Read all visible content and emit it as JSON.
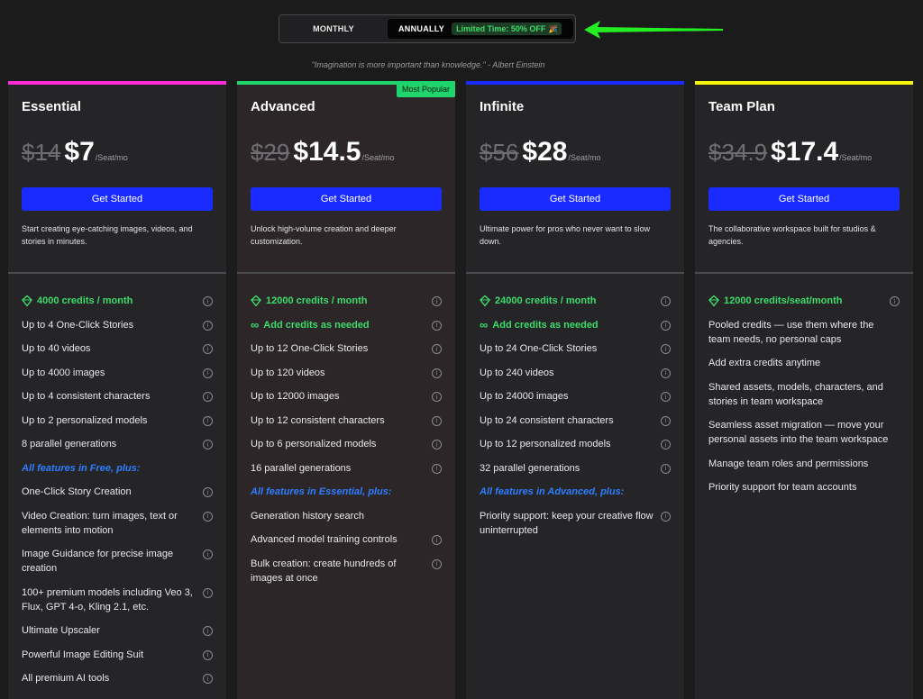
{
  "toggle": {
    "monthly_label": "MONTHLY",
    "annual_label": "ANNUALLY",
    "promo_label": "Limited Time: 50% OFF",
    "promo_icon": "🎉",
    "selected": "annually"
  },
  "quote": "\"Imagination is more important than knowledge.\" - Albert Einstein",
  "colors": {
    "essential_bar": "#ff2bd6",
    "advanced_bar": "#1ed46b",
    "infinite_bar": "#1a2bff",
    "team_bar": "#f4f40c",
    "button": "#1a2bff",
    "credits_green": "#3ddc6a",
    "section_blue": "#2f7dff"
  },
  "plans": [
    {
      "name": "Essential",
      "old_price": "$14",
      "price": "$7",
      "unit": "/Seat/mo",
      "button": "Get Started",
      "description": "Start creating eye-catching images, videos, and stories in minutes.",
      "credits": "4000 credits / month",
      "features": [
        "Up to 4 One-Click Stories",
        "Up to 40 videos",
        "Up to 4000 images",
        "Up to 4 consistent characters",
        "Up to 2 personalized models",
        "8 parallel generations"
      ],
      "section": "All features in Free, plus:",
      "extras": [
        "One-Click Story Creation",
        "Video Creation: turn images, text or elements into motion",
        "Image Guidance for precise image creation",
        "100+ premium models including Veo 3, Flux, GPT 4-o, Kling 2.1, etc.",
        "Ultimate Upscaler",
        "Powerful Image Editing Suit",
        "All premium AI tools"
      ]
    },
    {
      "name": "Advanced",
      "badge": "Most Popular",
      "old_price": "$29",
      "price": "$14.5",
      "unit": "/Seat/mo",
      "button": "Get Started",
      "description": "Unlock high-volume creation and deeper customization.",
      "credits": "12000 credits / month",
      "add_credits": "Add credits as needed",
      "features": [
        "Up to 12 One-Click Stories",
        "Up to 120 videos",
        "Up to 12000 images",
        "Up to 12 consistent characters",
        "Up to 6 personalized models",
        "16 parallel generations"
      ],
      "section": "All features in Essential, plus:",
      "extras": [
        "Generation history search",
        "Advanced model training controls",
        "Bulk creation: create hundreds of images at once"
      ]
    },
    {
      "name": "Infinite",
      "old_price": "$56",
      "price": "$28",
      "unit": "/Seat/mo",
      "button": "Get Started",
      "description": "Ultimate power for pros who never want to slow down.",
      "credits": "24000 credits / month",
      "add_credits": "Add credits as needed",
      "features": [
        "Up to 24 One-Click Stories",
        "Up to 240 videos",
        "Up to 24000 images",
        "Up to 24 consistent characters",
        "Up to 12 personalized models",
        "32 parallel generations"
      ],
      "section": "All features in Advanced, plus:",
      "extras": [
        "Priority support: keep your creative flow uninterrupted"
      ]
    },
    {
      "name": "Team Plan",
      "old_price": "$34.9",
      "price": "$17.4",
      "unit": "/Seat/mo",
      "button": "Get Started",
      "description": "The collaborative workspace built for studios & agencies.",
      "credits": "12000 credits/seat/month",
      "team_features": [
        "Pooled credits — use them where the team needs, no personal caps",
        "Add extra credits anytime",
        "Shared assets, models, characters, and stories in team workspace",
        "Seamless asset migration — move your personal assets into the team workspace",
        "Manage team roles and permissions",
        "Priority support for team accounts"
      ]
    }
  ]
}
